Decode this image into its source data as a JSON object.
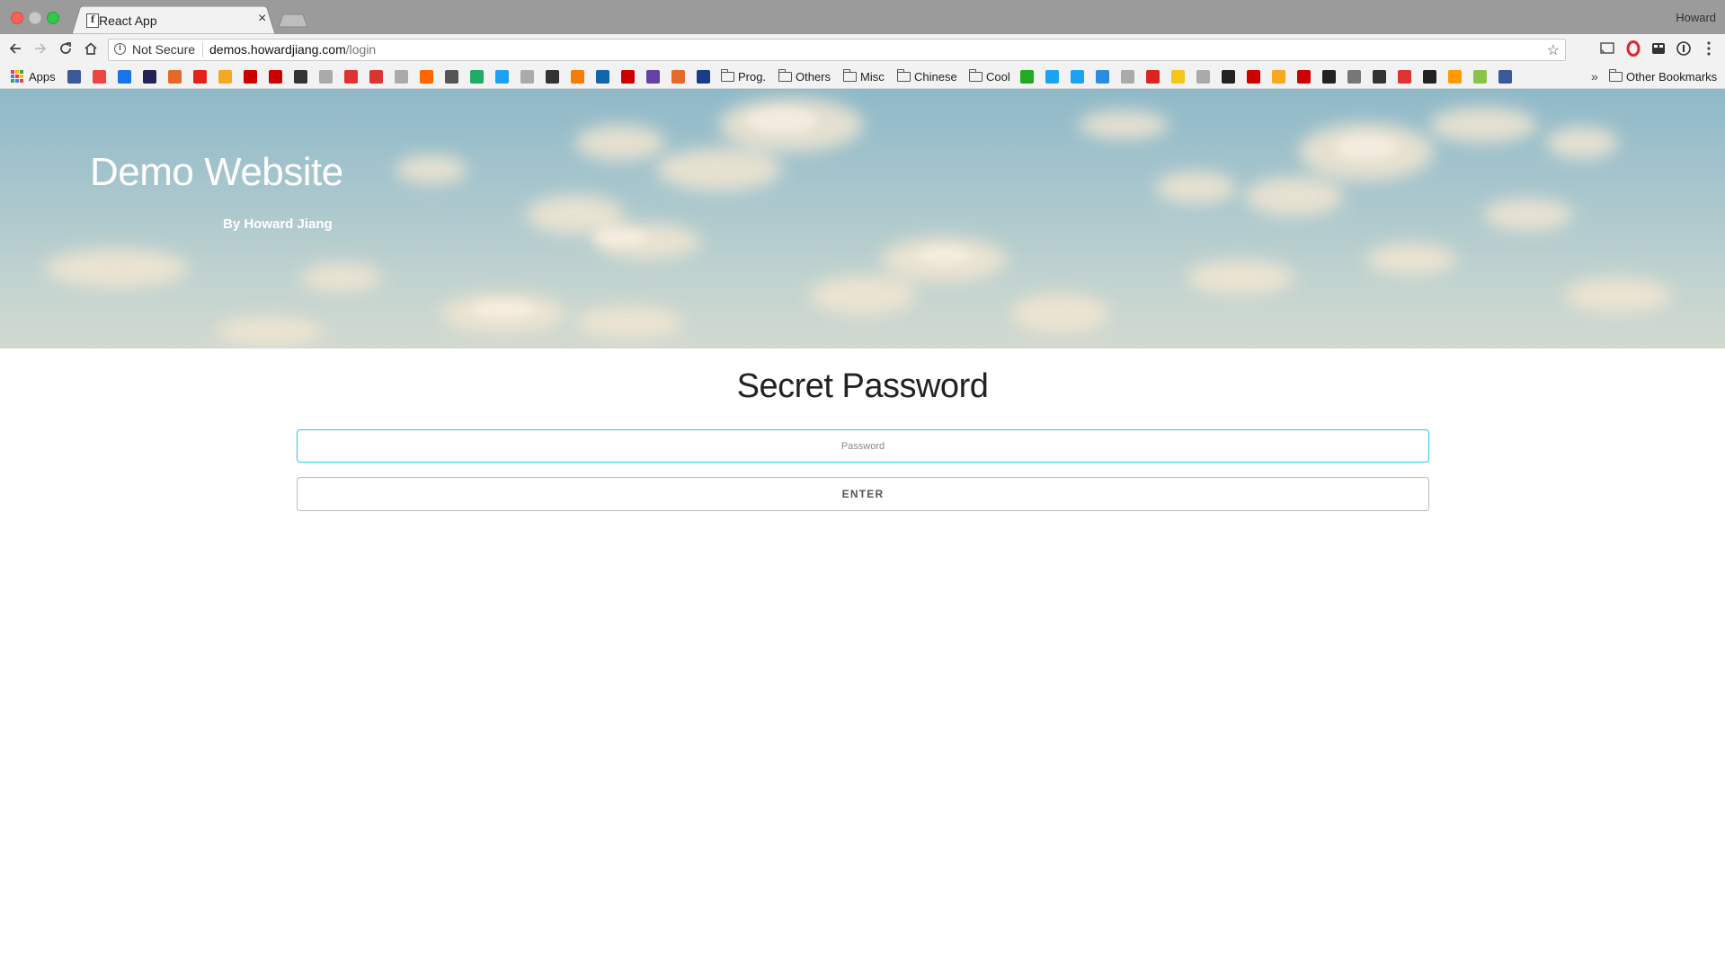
{
  "browser": {
    "tab_title": "React App",
    "tab_favicon": "f",
    "tab_close": "×",
    "profile_name": "Howard",
    "not_secure_label": "Not Secure",
    "url_host": "demos.howardjiang.com",
    "url_path": "/login",
    "info_glyph": "i",
    "star_glyph": "☆"
  },
  "bookmarks": {
    "apps_label": "Apps",
    "folders": [
      "Prog.",
      "Others",
      "Misc",
      "Chinese",
      "Cool"
    ],
    "more_glyph": "»",
    "other_label": "Other Bookmarks",
    "icon_colors": [
      "#3b5998",
      "#e44",
      "#1a73e8",
      "#225",
      "#e46a2a",
      "#e62117",
      "#f6a821",
      "#c00",
      "#c00",
      "#333",
      "#aaa",
      "#d33",
      "#d33",
      "#aaa",
      "#f60",
      "#555",
      "#2a6",
      "#1da1f2",
      "#aaa",
      "#333",
      "#f57d00",
      "#16a",
      "#c00",
      "#6441a5",
      "#e46a2a",
      "#1a3a8a",
      "#2a2",
      "#1da1f2",
      "#1da1f2",
      "#2a8de0",
      "#aaa",
      "#d22",
      "#f5c518",
      "#aaa",
      "#222",
      "#c00",
      "#f6a821",
      "#c00",
      "#222",
      "#777",
      "#333",
      "#d33",
      "#222",
      "#f90",
      "#8bc34a"
    ]
  },
  "hero": {
    "title": "Demo Website",
    "subtitle": "By Howard Jiang"
  },
  "login": {
    "heading": "Secret Password",
    "password_placeholder": "Password",
    "password_value": "",
    "enter_label": "ENTER",
    "accent_color": "#33c3f0"
  }
}
